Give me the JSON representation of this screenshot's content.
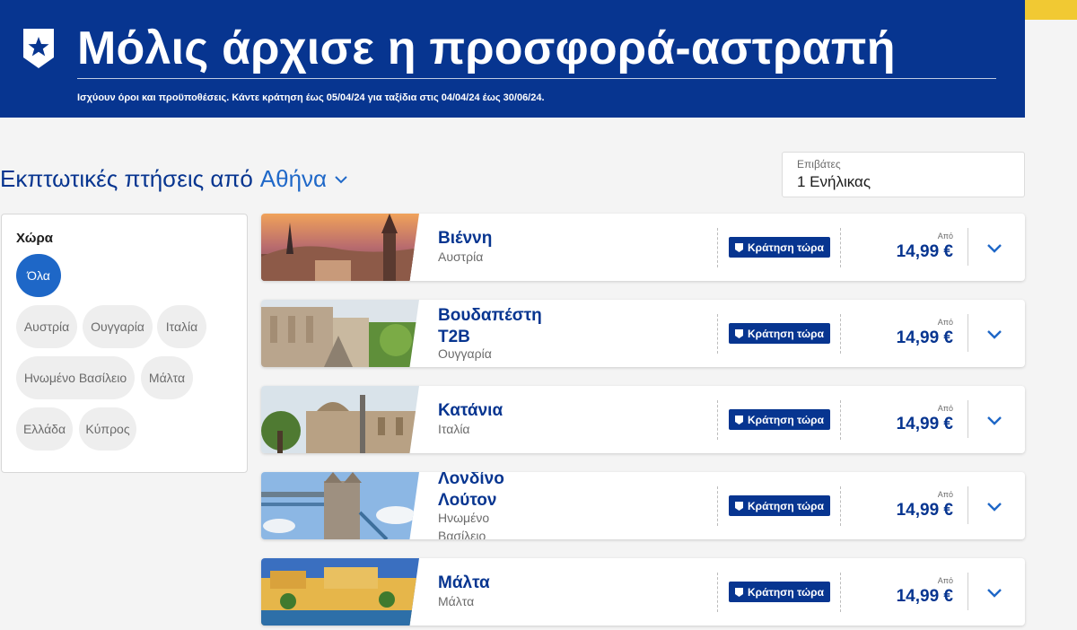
{
  "banner": {
    "title": "Μόλις άρχισε η προσφορά-αστραπή",
    "terms": "Ισχύουν όροι και προϋποθέσεις. Κάντε κράτηση έως 05/04/24 για ταξίδια στις 04/04/24 έως 30/06/24."
  },
  "heading": {
    "prefix": "Εκπτωτικές πτήσεις από",
    "city": "Αθήνα"
  },
  "passengers": {
    "label": "Επιβάτες",
    "value": "1 Ενήλικας"
  },
  "filter": {
    "title": "Χώρα",
    "chips": [
      "Όλα",
      "Αυστρία",
      "Ουγγαρία",
      "Ιταλία",
      "Ηνωμένο Βασίλειο",
      "Μάλτα",
      "Ελλάδα",
      "Κύπρος"
    ],
    "selected": "Όλα"
  },
  "colors": {
    "brand": "#073590",
    "accent": "#1e67c7",
    "yellow": "#f1c933"
  },
  "flights": [
    {
      "name": "Βιέννη",
      "country": "Αυστρία",
      "book": "Κράτηση τώρα",
      "from": "Από",
      "price": "14,99 €",
      "icon": "chevron-down-icon"
    },
    {
      "name": "Βουδαπέστη T2B",
      "country": "Ουγγαρία",
      "book": "Κράτηση τώρα",
      "from": "Από",
      "price": "14,99 €",
      "icon": "chevron-down-icon"
    },
    {
      "name": "Κατάνια",
      "country": "Ιταλία",
      "book": "Κράτηση τώρα",
      "from": "Από",
      "price": "14,99 €",
      "icon": "chevron-down-icon"
    },
    {
      "name": "Λονδίνο Λούτον",
      "country": "Ηνωμένο Βασίλειο",
      "book": "Κράτηση τώρα",
      "from": "Από",
      "price": "14,99 €",
      "icon": "chevron-down-icon"
    },
    {
      "name": "Μάλτα",
      "country": "Μάλτα",
      "book": "Κράτηση τώρα",
      "from": "Από",
      "price": "14,99 €",
      "icon": "chevron-down-icon"
    }
  ]
}
